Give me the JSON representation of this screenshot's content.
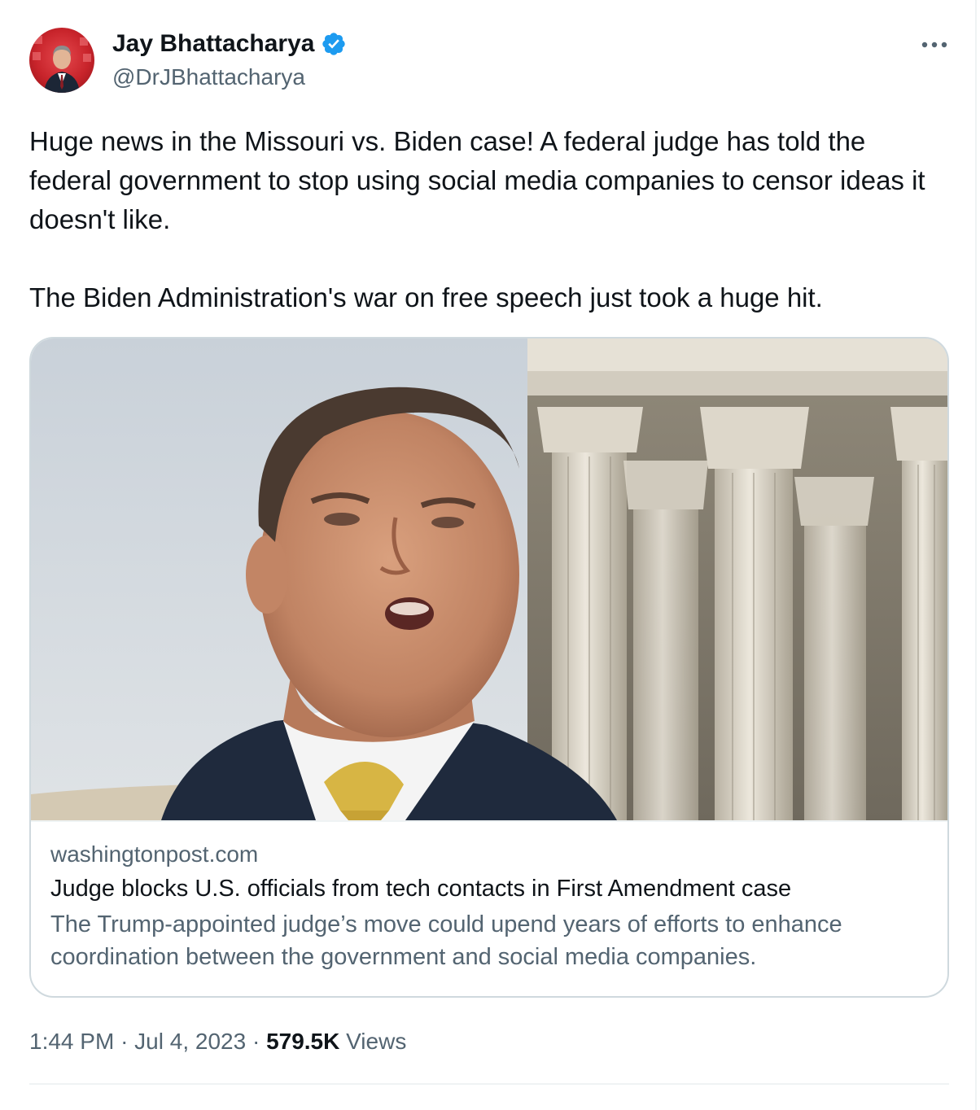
{
  "author": {
    "display_name": "Jay Bhattacharya",
    "handle": "@DrJBhattacharya",
    "verified": true,
    "verified_color": "#1d9bf0"
  },
  "tweet": {
    "paragraphs": [
      "Huge news in the Missouri vs. Biden case! A federal judge has told the federal government to stop using social media companies to censor ideas it doesn't like.",
      "The Biden Administration's war on free speech just took a huge hit."
    ]
  },
  "card": {
    "domain": "washingtonpost.com",
    "title": "Judge blocks U.S. officials from tech contacts in First Amendment case",
    "description": "The Trump-appointed judge’s move could upend years of efforts to enhance coordination between the government and social media companies."
  },
  "meta": {
    "time": "1:44 PM",
    "separator": "·",
    "date": "Jul 4, 2023",
    "views_count": "579.5K",
    "views_label": "Views"
  },
  "icons": {
    "more": "more-horizontal-icon",
    "verified": "verified-badge-icon"
  },
  "colors": {
    "text_primary": "#0f1419",
    "text_secondary": "#536471",
    "border": "#cfd9de",
    "accent": "#1d9bf0"
  }
}
